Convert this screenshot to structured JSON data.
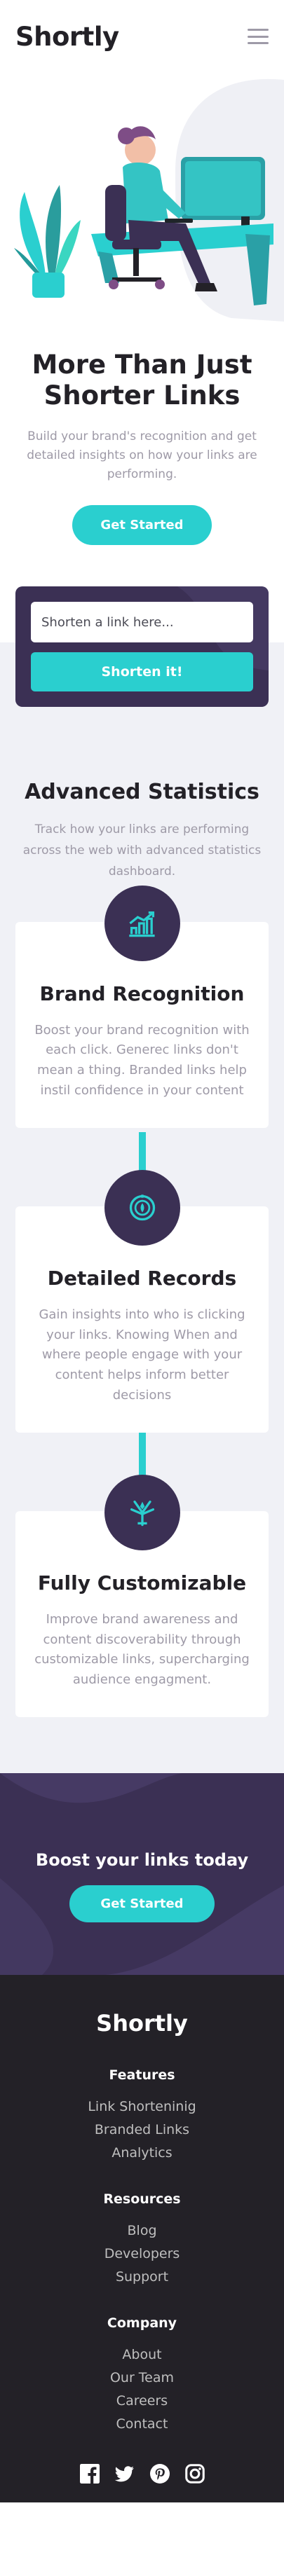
{
  "header": {
    "logo": "Shortly",
    "menu_icon": "hamburger-menu-icon"
  },
  "hero": {
    "illustration": "person-working-at-desk-illustration",
    "title": "More Than Just Shorter Links",
    "text": "Build your brand's recognition and get detailed insights on how your links are performing.",
    "cta": "Get Started"
  },
  "shorten": {
    "placeholder": "Shorten a link here...",
    "button": "Shorten it!"
  },
  "stats": {
    "title": "Advanced Statistics",
    "text": "Track how your links are performing across the web with advanced statistics dashboard.",
    "cards": [
      {
        "icon": "brand-recognition-icon",
        "title": "Brand Recognition",
        "text": "Boost your brand recognition with each click. Generec links don't mean a thing. Branded links help instil confidence in your content"
      },
      {
        "icon": "detailed-records-icon",
        "title": "Detailed Records",
        "text": "Gain insights into who is clicking your links. Knowing When and where people engage with your content helps inform better decisions"
      },
      {
        "icon": "fully-customizable-icon",
        "title": "Fully Customizable",
        "text": "Improve brand awareness and content discoverability through customizable links, supercharging audience engagment."
      }
    ]
  },
  "boost": {
    "title": "Boost your links today",
    "cta": "Get Started"
  },
  "footer": {
    "logo": "Shortly",
    "columns": [
      {
        "title": "Features",
        "links": [
          "Link Shorteninig",
          "Branded Links",
          "Analytics"
        ]
      },
      {
        "title": "Resources",
        "links": [
          "Blog",
          "Developers",
          "Support"
        ]
      },
      {
        "title": "Company",
        "links": [
          "About",
          "Our Team",
          "Careers",
          "Contact"
        ]
      }
    ],
    "social": [
      "facebook-icon",
      "twitter-icon",
      "pinterest-icon",
      "instagram-icon"
    ]
  },
  "colors": {
    "cyan": "#2acfcf",
    "dark_violet": "#3b3054",
    "very_dark": "#232127",
    "gray": "#9e9aa7",
    "light_bg": "#f0f1f6"
  }
}
